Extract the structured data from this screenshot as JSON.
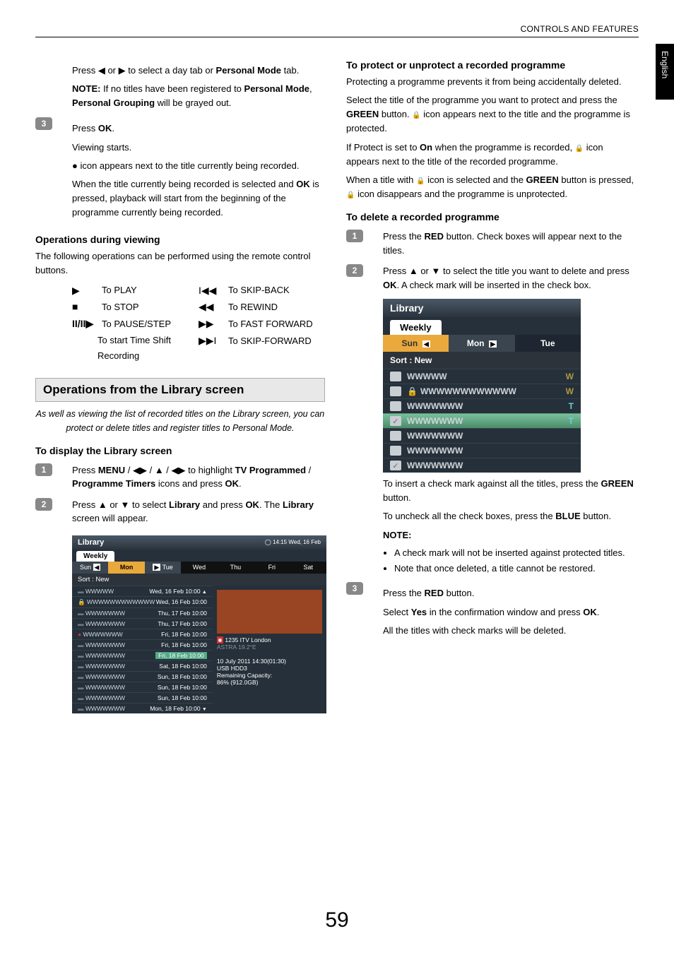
{
  "page_header": "CONTROLS AND FEATURES",
  "language_tab": "English",
  "page_number": "59",
  "left": {
    "line1_pre": "Press ",
    "line1_mid": " or ",
    "line1_post": " to select a day tab or ",
    "line1_bold": "Personal Mode",
    "line1_end": " tab.",
    "note_label": "NOTE:",
    "note_text_1": " If no titles have been registered to ",
    "note_b1": "Personal Mode",
    "note_text_2": ", ",
    "note_b2": "Personal Grouping",
    "note_text_3": " will be grayed out.",
    "step3_num": "3",
    "step3_pre": "Press ",
    "step3_bold": "OK",
    "step3_post": ".",
    "viewing_starts": "Viewing starts.",
    "dot_para": " icon appears next to the title currently being recorded.",
    "rec_para_1": "When the title currently being recorded is selected and ",
    "rec_para_b": "OK",
    "rec_para_2": " is pressed, playback will start from the beginning of the programme currently being recorded.",
    "ops_viewing_h": "Operations during viewing",
    "ops_viewing_p": "The following operations can be performed using the remote control buttons.",
    "ctl_play": "To PLAY",
    "ctl_stop": "To STOP",
    "ctl_pause": "To PAUSE/STEP",
    "ctl_timeshift": "To start Time Shift Recording",
    "ctl_skipback": "To SKIP-BACK",
    "ctl_rewind": "To REWIND",
    "ctl_ff": "To FAST FORWARD",
    "ctl_skipfwd": "To SKIP-FORWARD",
    "section_bar": "Operations from the Library screen",
    "section_intro": "As well as viewing the list of recorded titles on the Library screen, you can protect or delete titles and register titles to Personal Mode.",
    "display_lib_h": "To display the Library screen",
    "s1_num": "1",
    "s1_a": "Press ",
    "s1_menu": "MENU",
    "s1_b": " / ",
    "s1_c": " to highlight ",
    "s1_tvp": "TV Programmed",
    "s1_d": " / ",
    "s1_pt": "Programme Timers",
    "s1_e": " icons and press ",
    "s1_ok": "OK",
    "s1_f": ".",
    "s2_num": "2",
    "s2_a": "Press ",
    "s2_b": " or ",
    "s2_c": " to select ",
    "s2_lib": "Library",
    "s2_d": " and press ",
    "s2_ok": "OK",
    "s2_e": ". The ",
    "s2_lib2": "Library",
    "s2_f": " screen will appear.",
    "lib_title": "Library",
    "lib_time": "14:15 Wed, 16 Feb",
    "lib_weekly": "Weekly",
    "lib_days": [
      "Sun",
      "Mon",
      "Tue",
      "Wed",
      "Thu",
      "Fri",
      "Sat"
    ],
    "lib_sort": "Sort : New",
    "lib_rows": [
      {
        "n": "WWWWW",
        "d": "Wed, 16 Feb 10:00"
      },
      {
        "n": "WWWWWWWWWWWW",
        "d": "Wed, 16 Feb 10:00",
        "lock": true
      },
      {
        "n": "WWWWWWW",
        "d": "Thu, 17 Feb 10:00"
      },
      {
        "n": "WWWWWWW",
        "d": "Thu, 17 Feb 10:00"
      },
      {
        "n": "WWWWWWW",
        "d": "Fri, 18 Feb 10:00",
        "dot": true
      },
      {
        "n": "WWWWWWW",
        "d": "Fri, 18 Feb 10:00"
      },
      {
        "n": "WWWWWWW",
        "d": "Fri, 18 Feb 10:00",
        "sel": true
      },
      {
        "n": "WWWWWWW",
        "d": "Sat, 18 Feb 10:00"
      },
      {
        "n": "WWWWWWW",
        "d": "Sun, 18 Feb 10:00"
      },
      {
        "n": "WWWWWWW",
        "d": "Sun, 18 Feb 10:00"
      },
      {
        "n": "WWWWWWW",
        "d": "Sun, 18 Feb 10:00"
      },
      {
        "n": "WWWWWWW",
        "d": "Mon, 18 Feb 10:00"
      }
    ],
    "lib_side_ch": "1235 ITV London",
    "lib_side_sat": "ASTRA 19.2°E",
    "lib_side_date": "10 July 2011  14:30(01:30)",
    "lib_side_dev": "USB HDD3",
    "lib_side_cap_l": "Remaining Capacity:",
    "lib_side_cap_v": "86% (912.0GB)"
  },
  "right": {
    "protect_h": "To protect or unprotect a recorded programme",
    "protect_p1": "Protecting a programme prevents it from being accidentally deleted.",
    "protect_p2_a": "Select the title of the programme you want to protect and press the ",
    "protect_green": "GREEN",
    "protect_p2_b": " button. ",
    "protect_p2_c": " icon appears next to the title and the programme is protected.",
    "protect_p3_a": "If Protect is set to ",
    "protect_on": "On",
    "protect_p3_b": " when the programme is recorded, ",
    "protect_p3_c": " icon appears next to the title of the recorded programme.",
    "protect_p4_a": "When a title with ",
    "protect_p4_b": " icon is selected and the ",
    "protect_p4_c": " button is pressed, ",
    "protect_p4_d": " icon disappears and the programme is unprotected.",
    "delete_h": "To delete a recorded programme",
    "d1_num": "1",
    "d1_a": "Press the ",
    "d1_red": "RED",
    "d1_b": " button. Check boxes will appear next to the titles.",
    "d2_num": "2",
    "d2_a": "Press ",
    "d2_b": " or ",
    "d2_c": " to select the title you want to delete and press ",
    "d2_ok": "OK",
    "d2_d": ". A check mark will be inserted in the check box.",
    "lib2_title": "Library",
    "lib2_weekly": "Weekly",
    "lib2_days": [
      "Sun",
      "Mon",
      "Tue"
    ],
    "lib2_sort": "Sort : New",
    "lib2_rows": [
      {
        "txt": "WWWWW",
        "badge": "W",
        "bcol": "w"
      },
      {
        "txt": "WWWWWWWWWWWW",
        "badge": "W",
        "bcol": "w",
        "lock": true
      },
      {
        "txt": "WWWWWWW",
        "badge": "T",
        "bcol": "t"
      },
      {
        "txt": "WWWWWWW",
        "badge": "T",
        "bcol": "t",
        "sel": true,
        "chk": true
      },
      {
        "txt": "WWWWWWW",
        "badge": ""
      },
      {
        "txt": "WWWWWWW",
        "badge": ""
      },
      {
        "txt": "WWWWWWW",
        "badge": "",
        "bottomchk": true
      }
    ],
    "after_lib_p1_a": "To insert a check mark against all the titles, press the ",
    "after_lib_green": "GREEN",
    "after_lib_p1_b": " button.",
    "after_lib_p2_a": "To uncheck all the check boxes, press the ",
    "after_lib_blue": "BLUE",
    "after_lib_p2_b": " button.",
    "note_h": "NOTE:",
    "note_li1": "A check mark will not be inserted against protected titles.",
    "note_li2": "Note that once deleted, a title cannot be restored.",
    "d3_num": "3",
    "d3_a": "Press the ",
    "d3_red": "RED",
    "d3_b": " button.",
    "d3_p2_a": "Select ",
    "d3_yes": "Yes",
    "d3_p2_b": " in the confirmation window and press ",
    "d3_ok": "OK",
    "d3_p2_c": ".",
    "d3_p3": "All the titles with check marks will be deleted."
  }
}
